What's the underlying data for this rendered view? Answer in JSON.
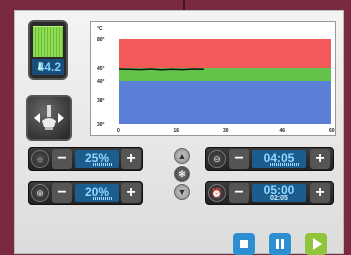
{
  "meter": {
    "value": "44.2",
    "mini_icon": "thermometer-icon"
  },
  "chart_data": {
    "type": "line",
    "ylabel": "°C",
    "yticks": [
      "80°",
      "45°",
      "40°",
      "38°",
      "30°"
    ],
    "xticks": [
      "0",
      "16",
      "30",
      "46",
      "60"
    ],
    "bands": [
      {
        "from": 45,
        "to": 80,
        "color": "#f25a5a"
      },
      {
        "from": 40,
        "to": 45,
        "color": "#62c24a"
      },
      {
        "from": 30,
        "to": 40,
        "color": "#5b7fd6"
      }
    ],
    "series": [
      {
        "x": [
          0,
          3,
          6,
          9,
          12,
          15,
          18,
          21,
          24
        ],
        "values": [
          44.6,
          44.5,
          44.4,
          44.6,
          44.3,
          44.5,
          44.4,
          44.6,
          44.5
        ]
      }
    ]
  },
  "controls": {
    "left_top": {
      "value": "25%",
      "icon": "brightness-icon"
    },
    "left_bottom": {
      "value": "20%",
      "icon": "target-icon"
    },
    "right_top": {
      "value": "04:05",
      "icon": "clock-icon"
    },
    "right_bottom": {
      "value": "05:00",
      "subvalue": "02:05",
      "icon": "alarm-icon"
    }
  },
  "buttons": {
    "stop": {
      "color": "#2d8fd1",
      "icon": "stop-icon"
    },
    "pause": {
      "color": "#2d8fd1",
      "icon": "pause-icon"
    },
    "play": {
      "color": "#8fc43b",
      "icon": "play-icon"
    }
  }
}
